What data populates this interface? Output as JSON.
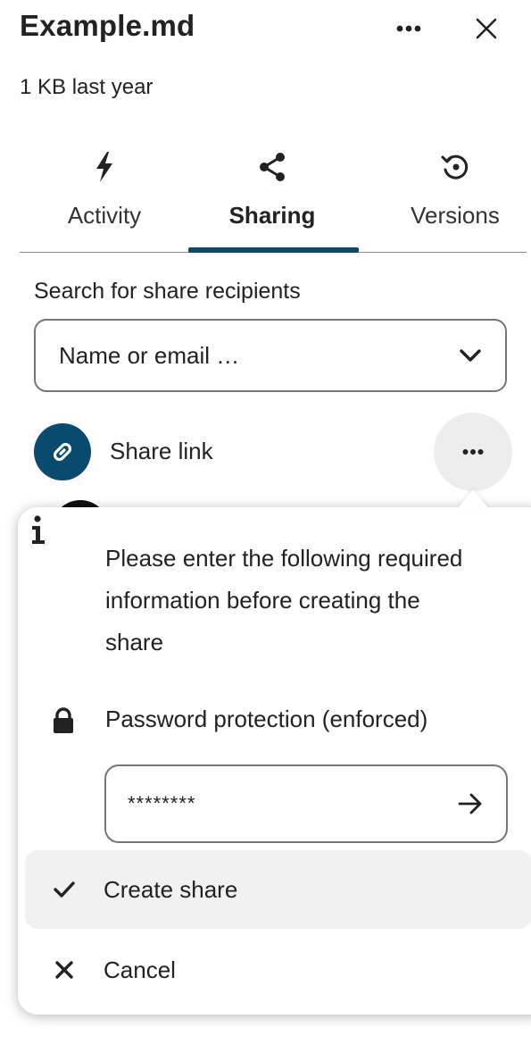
{
  "header": {
    "title": "Example.md",
    "subtitle": "1 KB last year",
    "more_icon": "more-horizontal-icon",
    "close_icon": "close-icon"
  },
  "tabs": [
    {
      "label": "Activity",
      "icon": "lightning-icon",
      "active": false
    },
    {
      "label": "Sharing",
      "icon": "share-icon",
      "active": true
    },
    {
      "label": "Versions",
      "icon": "history-icon",
      "active": false
    }
  ],
  "search": {
    "label": "Search for share recipients",
    "placeholder": "Name or email …"
  },
  "share_link": {
    "label": "Share link",
    "icon": "link-icon"
  },
  "popover": {
    "info_text": "Please enter the following required information before creating the share",
    "password_label": "Password protection (enforced)",
    "password_value": "********",
    "create_label": "Create share",
    "cancel_label": "Cancel"
  },
  "colors": {
    "accent": "#0b4a6f",
    "hover_background": "#f1f1f1",
    "border": "#767676"
  }
}
